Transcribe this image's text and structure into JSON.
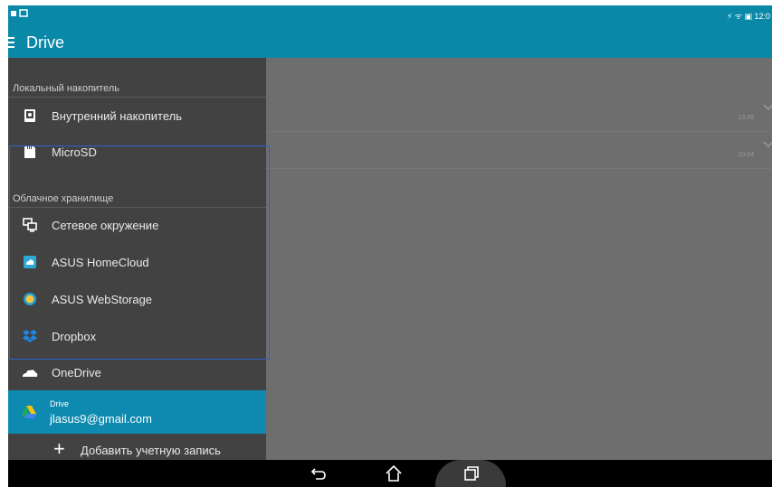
{
  "status_bar": {
    "right_text": "⚡ ᯤ  ▣ 12:0"
  },
  "app_bar": {
    "title": "Drive"
  },
  "drawer": {
    "local_header": "Локальный накопитель",
    "cloud_header": "Облачное хранилище",
    "local_items": [
      {
        "label": "Внутренний накопитель",
        "icon": "internal-storage-icon"
      },
      {
        "label": "MicroSD",
        "icon": "sd-card-icon"
      }
    ],
    "cloud_items": [
      {
        "label": "Сетевое окружение",
        "icon": "network-icon"
      },
      {
        "label": "ASUS HomeCloud",
        "icon": "homecloud-icon"
      },
      {
        "label": "ASUS WebStorage",
        "icon": "webstorage-icon"
      },
      {
        "label": "Dropbox",
        "icon": "dropbox-icon"
      },
      {
        "label": "OneDrive",
        "icon": "onedrive-icon"
      }
    ],
    "account": {
      "service": "Drive",
      "email": "jlasus9@gmail.com"
    },
    "add_account_label": "Добавить учетную запись"
  },
  "content": {
    "rows": [
      {
        "time": "13:39"
      },
      {
        "time": "10:04"
      }
    ]
  },
  "colors": {
    "accent": "#0a88a8",
    "drawer_bg": "#424242",
    "selected_bg": "#0e8ab0",
    "selection_border": "#2d62c8"
  }
}
